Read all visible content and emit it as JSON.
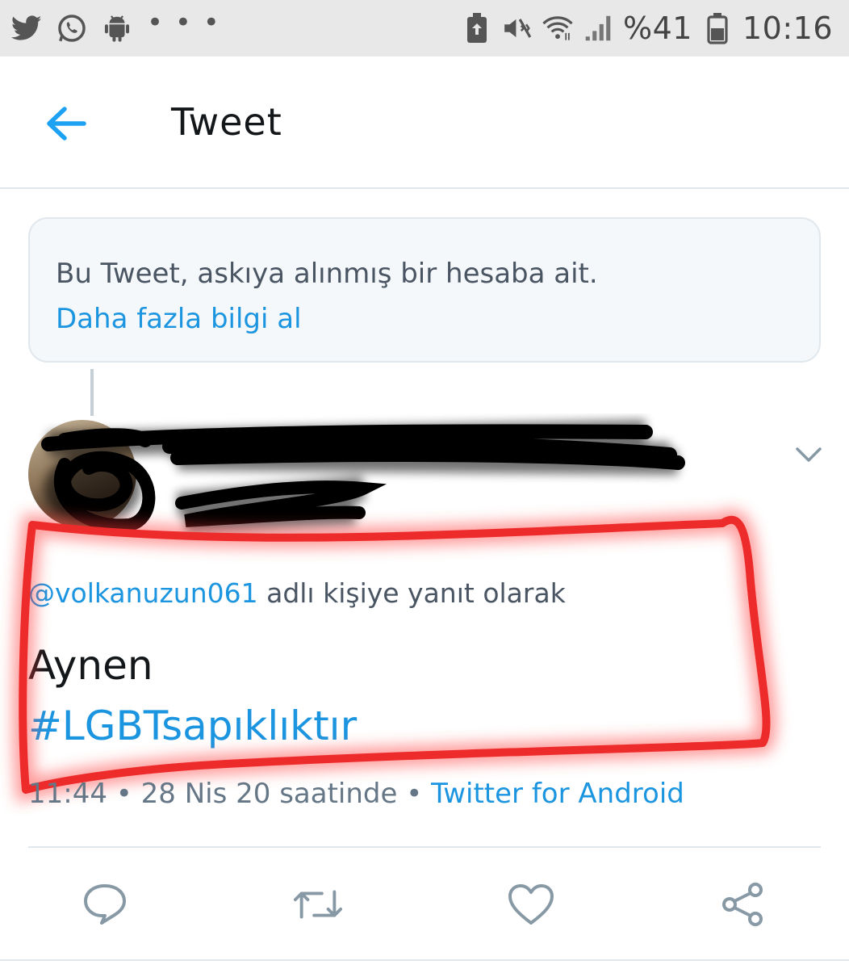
{
  "status_bar": {
    "icons_left": [
      "twitter-icon",
      "whatsapp-icon",
      "android-icon"
    ],
    "overflow": "• • •",
    "icons_right": [
      "battery-saver-icon",
      "mute-vibrate-icon",
      "wifi-icon",
      "signal-icon",
      "battery-icon"
    ],
    "battery_percent": "%41",
    "time": "10:16"
  },
  "app_bar": {
    "title": "Tweet",
    "back_icon": "arrow-left-icon"
  },
  "notice": {
    "text": "Bu Tweet, askıya alınmış bir hesaba ait.",
    "link": "Daha fazla bilgi al"
  },
  "tweet": {
    "reply_to_handle": "@volkanuzun061",
    "reply_suffix": " adlı kişiye yanıt olarak",
    "text": "Aynen",
    "hashtag": "#LGBTsapıklıktır",
    "timestamp": "11:44 • 28 Nis 20 saatinde • ",
    "source": "Twitter for Android",
    "menu_icon": "chevron-down-icon"
  },
  "actions": [
    "reply-icon",
    "retweet-icon",
    "like-icon",
    "share-icon"
  ],
  "colors": {
    "accent": "#1b95e0",
    "highlight": "#ee2b2b",
    "status_bar_bg": "#e8e8e8",
    "notice_bg": "#f5f8fa"
  }
}
